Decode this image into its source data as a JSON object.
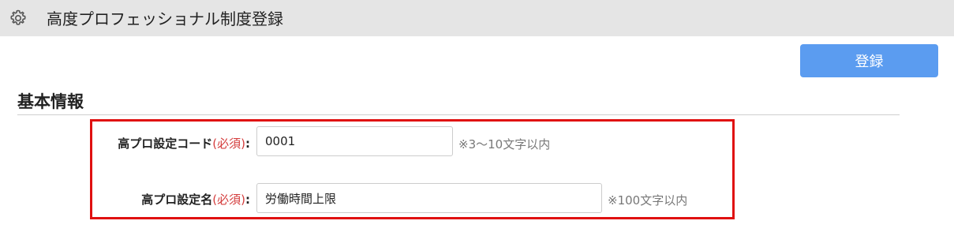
{
  "header": {
    "icon": "gear-icon",
    "title": "高度プロフェッショナル制度登録"
  },
  "toolbar": {
    "register_label": "登録",
    "register_color": "#5b9cf0"
  },
  "section": {
    "title": "基本情報"
  },
  "form": {
    "code": {
      "label": "高プロ設定コード",
      "required": "(必須)",
      "colon": ":",
      "value": "0001",
      "hint": "※3〜10文字以内"
    },
    "name": {
      "label": "高プロ設定名",
      "required": "(必須)",
      "colon": ":",
      "value": "労働時間上限",
      "hint": "※100文字以内"
    }
  },
  "highlight_color": "#e01010"
}
